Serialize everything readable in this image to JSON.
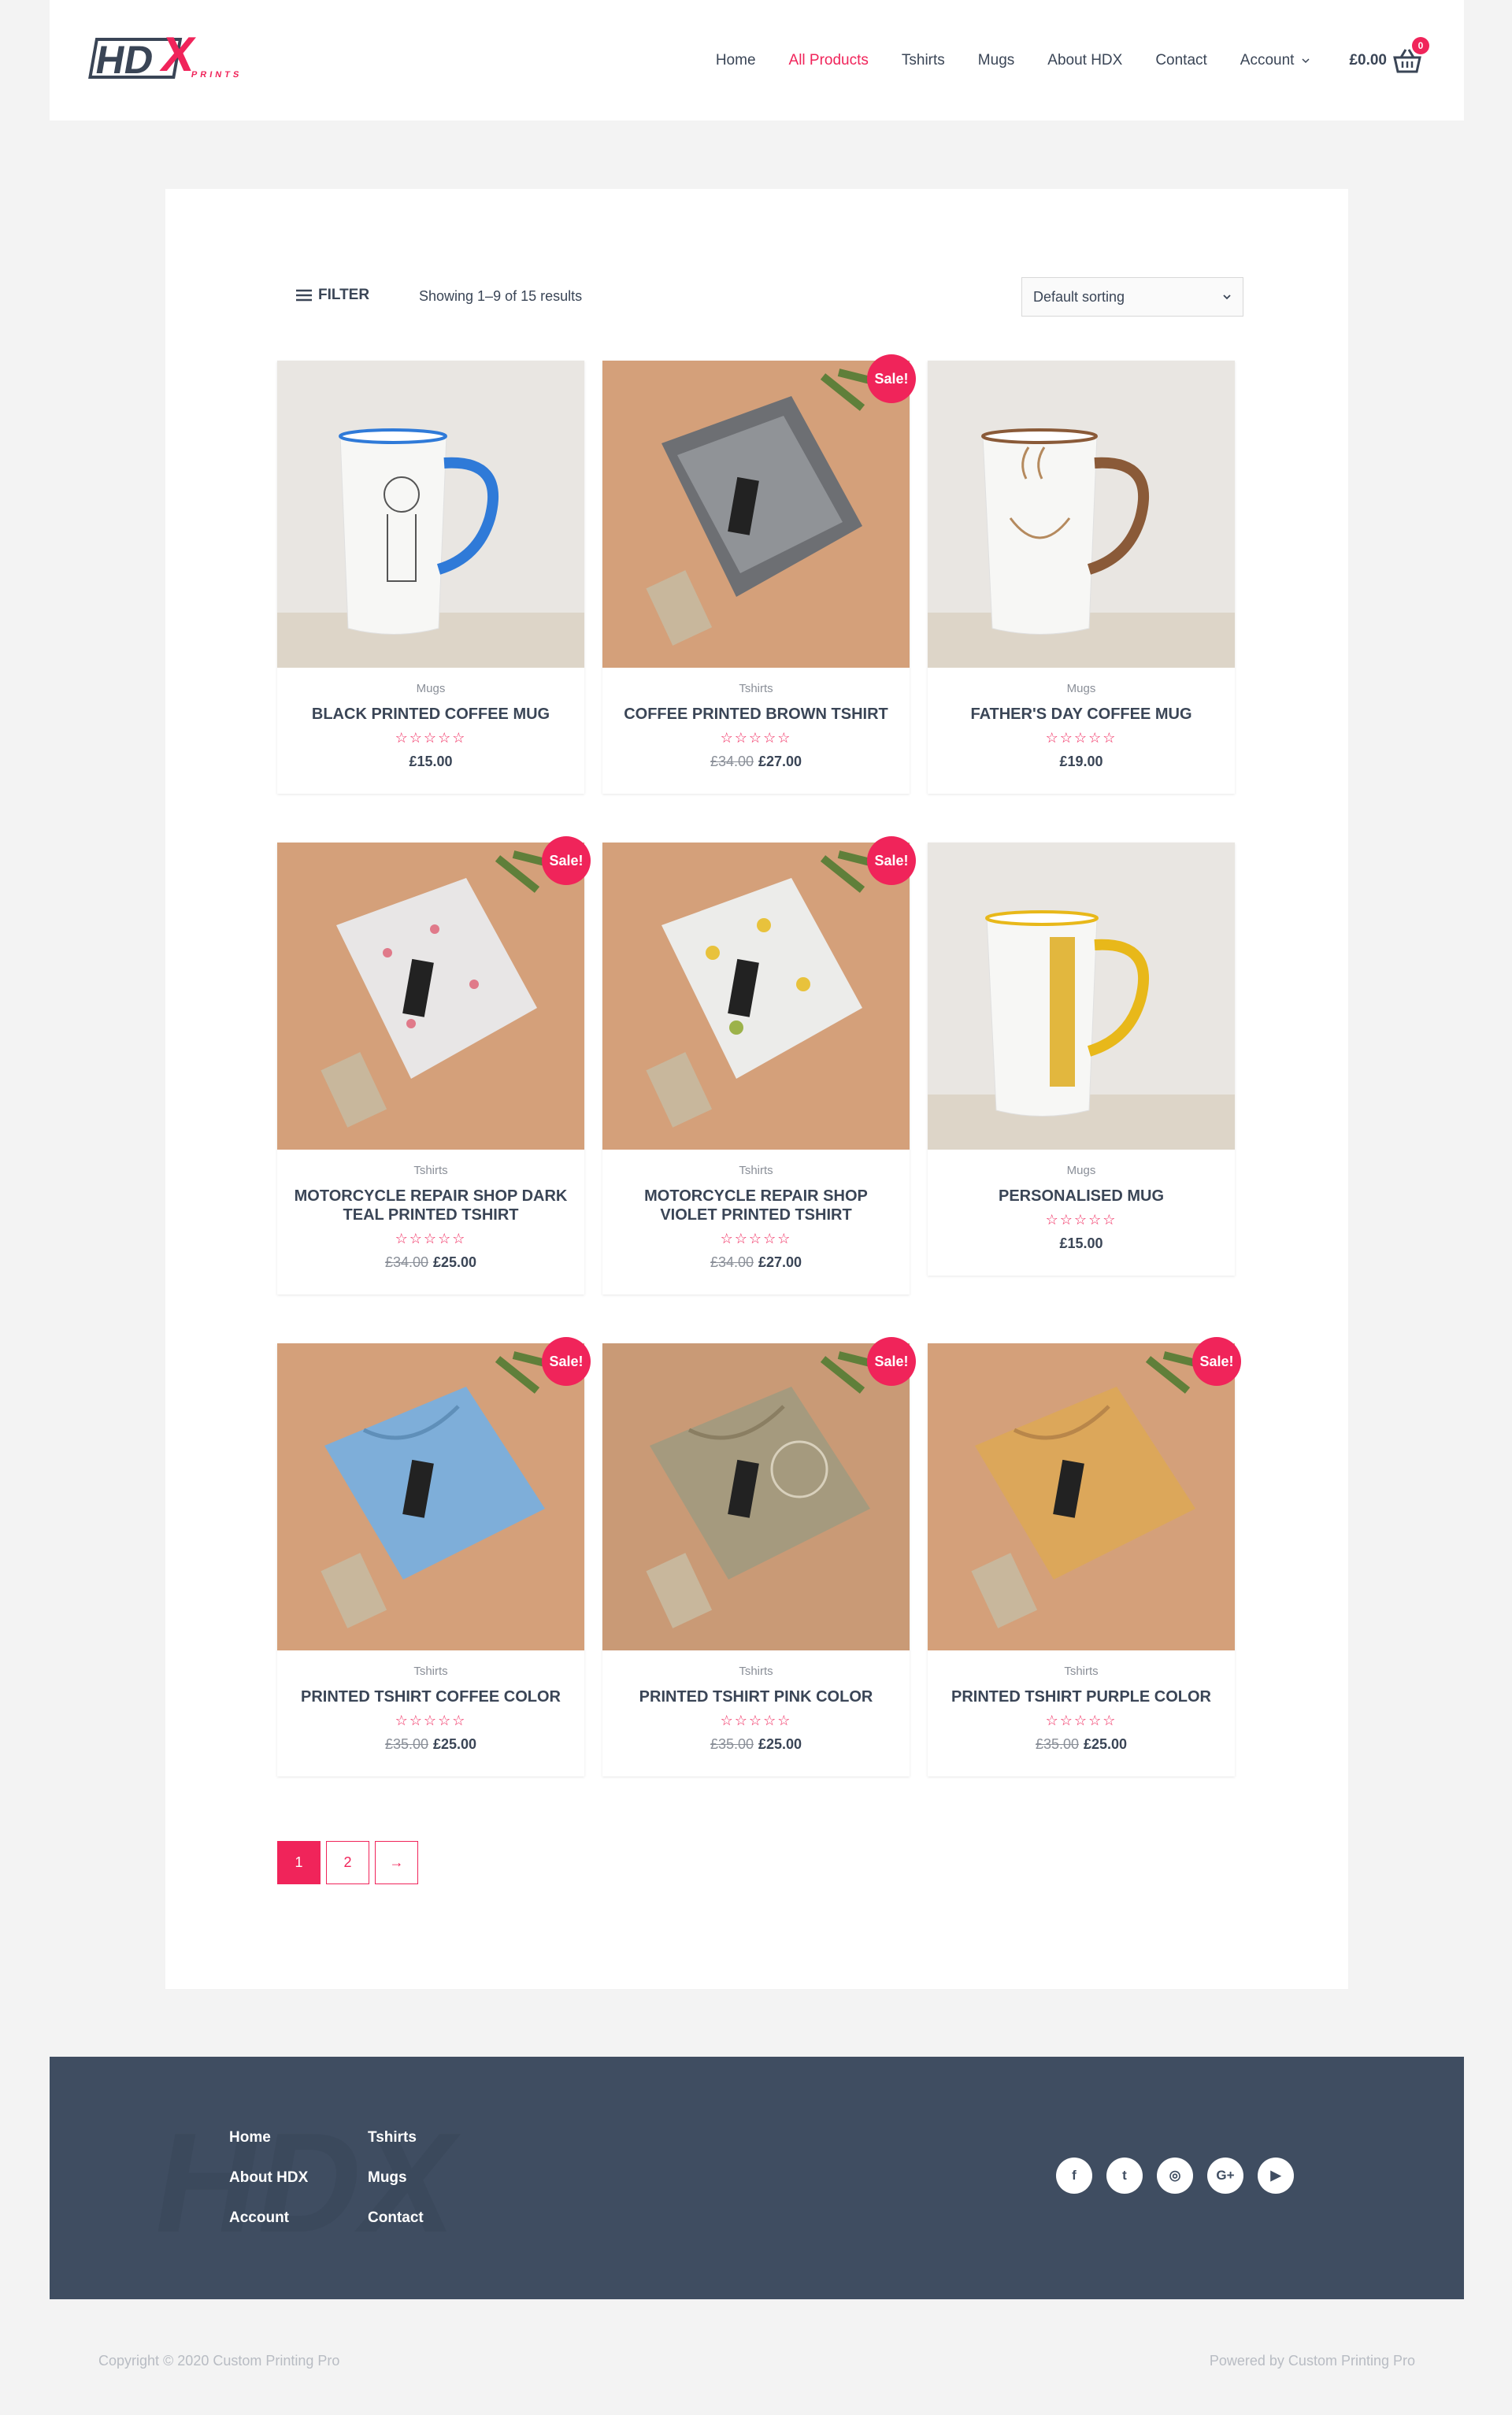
{
  "header": {
    "logo_text": "HDX",
    "logo_sub": "PRINTS",
    "nav": [
      {
        "label": "Home"
      },
      {
        "label": "All Products"
      },
      {
        "label": "Tshirts"
      },
      {
        "label": "Mugs"
      },
      {
        "label": "About HDX"
      },
      {
        "label": "Contact"
      },
      {
        "label": "Account"
      }
    ],
    "cart_total": "£0.00",
    "cart_count": "0"
  },
  "colors": {
    "accent": "#f0245a",
    "text": "#3a4556",
    "footer": "#3f4d61"
  },
  "toolbar": {
    "filter_label": "FILTER",
    "result_count": "Showing 1–9 of 15 results",
    "sort_selected": "Default sorting"
  },
  "products": [
    {
      "category": "Mugs",
      "name": "BLACK PRINTED COFFEE MUG",
      "old_price": "",
      "price": "£15.00",
      "sale": "",
      "rating": 0
    },
    {
      "category": "Tshirts",
      "name": "COFFEE PRINTED BROWN TSHIRT",
      "old_price": "£34.00",
      "price": "£27.00",
      "sale": "Sale!",
      "rating": 0
    },
    {
      "category": "Mugs",
      "name": "FATHER'S DAY COFFEE MUG",
      "old_price": "",
      "price": "£19.00",
      "sale": "",
      "rating": 0
    },
    {
      "category": "Tshirts",
      "name": "MOTORCYCLE REPAIR SHOP DARK TEAL PRINTED TSHIRT",
      "old_price": "£34.00",
      "price": "£25.00",
      "sale": "Sale!",
      "rating": 0
    },
    {
      "category": "Tshirts",
      "name": "MOTORCYCLE REPAIR SHOP VIOLET PRINTED TSHIRT",
      "old_price": "£34.00",
      "price": "£27.00",
      "sale": "Sale!",
      "rating": 0
    },
    {
      "category": "Mugs",
      "name": "PERSONALISED MUG",
      "old_price": "",
      "price": "£15.00",
      "sale": "",
      "rating": 0
    },
    {
      "category": "Tshirts",
      "name": "PRINTED TSHIRT COFFEE COLOR",
      "old_price": "£35.00",
      "price": "£25.00",
      "sale": "Sale!",
      "rating": 0
    },
    {
      "category": "Tshirts",
      "name": "PRINTED TSHIRT PINK COLOR",
      "old_price": "£35.00",
      "price": "£25.00",
      "sale": "Sale!",
      "rating": 0
    },
    {
      "category": "Tshirts",
      "name": "PRINTED TSHIRT PURPLE COLOR",
      "old_price": "£35.00",
      "price": "£25.00",
      "sale": "Sale!",
      "rating": 0
    }
  ],
  "pagination": {
    "pages": [
      "1",
      "2"
    ],
    "next": "→",
    "current": "1"
  },
  "footer": {
    "col1": [
      {
        "label": "Home"
      },
      {
        "label": "About HDX"
      },
      {
        "label": "Account"
      }
    ],
    "col2": [
      {
        "label": "Tshirts"
      },
      {
        "label": "Mugs"
      },
      {
        "label": "Contact"
      }
    ],
    "social": [
      {
        "icon": "facebook-icon",
        "glyph": "f"
      },
      {
        "icon": "twitter-icon",
        "glyph": "t"
      },
      {
        "icon": "instagram-icon",
        "glyph": "◎"
      },
      {
        "icon": "google-plus-icon",
        "glyph": "G+"
      },
      {
        "icon": "youtube-icon",
        "glyph": "▶"
      }
    ],
    "copyright": "Copyright © 2020 Custom Printing Pro",
    "powered": "Powered by Custom Printing Pro"
  }
}
